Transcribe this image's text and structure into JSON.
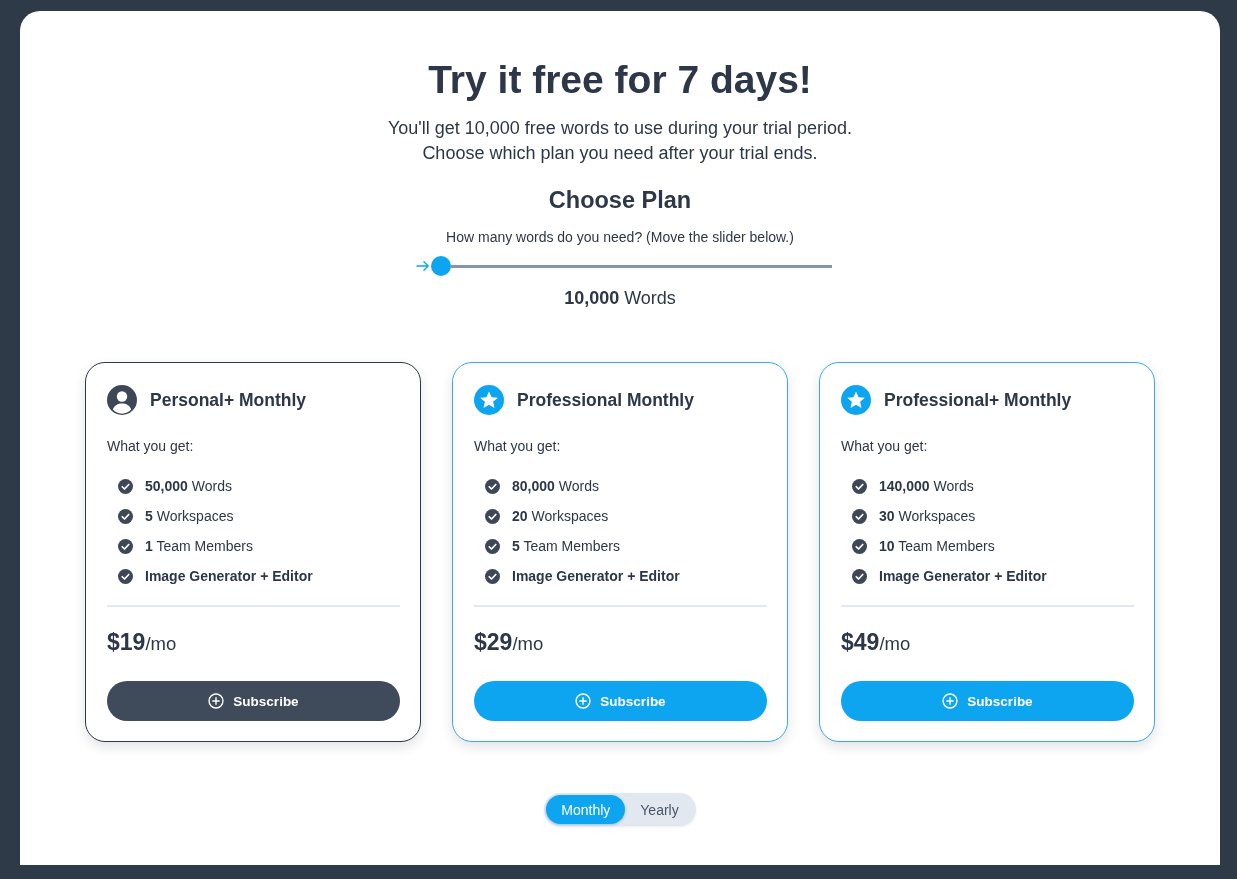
{
  "header": {
    "title": "Try it free for 7 days!",
    "subtitle_lines": [
      "You'll get 10,000 free words to use during your trial period.",
      "Choose which plan you need after your trial ends."
    ]
  },
  "plan_chooser": {
    "heading": "Choose Plan",
    "question": "How many words do you need? (Move the slider below.)",
    "slider": {
      "level": 0
    },
    "reading": "**10,000** Words"
  },
  "plans": [
    {
      "kind": "personal",
      "selected": true,
      "name": "Personal+ Monthly",
      "features_heading": "What you get:",
      "features": [
        {
          "kind": "count",
          "text": "**50,000** Words"
        },
        {
          "kind": "count",
          "text": "**5** Workspaces"
        },
        {
          "kind": "count",
          "text": "**1** Team Members"
        },
        {
          "kind": "addon",
          "text": "Image Generator + Editor"
        }
      ],
      "price": "$19",
      "period": "/mo",
      "button": "Subscribe"
    },
    {
      "kind": "professional",
      "selected": false,
      "name": "Professional Monthly",
      "features_heading": "What you get:",
      "features": [
        {
          "kind": "count",
          "text": "**80,000** Words"
        },
        {
          "kind": "count",
          "text": "**20** Workspaces"
        },
        {
          "kind": "count",
          "text": "**5** Team Members"
        },
        {
          "kind": "addon",
          "text": "Image Generator + Editor"
        }
      ],
      "price": "$29",
      "period": "/mo",
      "button": "Subscribe"
    },
    {
      "kind": "professional",
      "selected": false,
      "name": "Professional+ Monthly",
      "features_heading": "What you get:",
      "features": [
        {
          "kind": "count",
          "text": "**140,000** Words"
        },
        {
          "kind": "count",
          "text": "**30** Workspaces"
        },
        {
          "kind": "count",
          "text": "**10** Team Members"
        },
        {
          "kind": "addon",
          "text": "Image Generator + Editor"
        }
      ],
      "price": "$49",
      "period": "/mo",
      "button": "Subscribe"
    }
  ],
  "billing": {
    "options": [
      {
        "label": "Monthly",
        "selected": true
      },
      {
        "label": "Yearly",
        "selected": false
      }
    ]
  }
}
